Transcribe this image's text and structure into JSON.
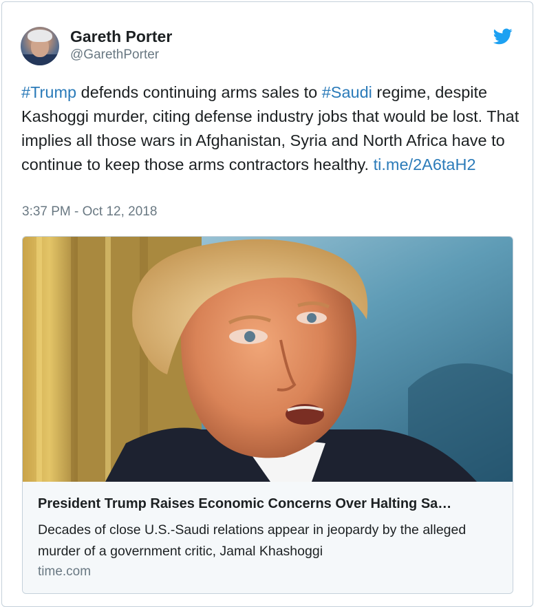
{
  "author": {
    "name": "Gareth Porter",
    "handle": "@GarethPorter"
  },
  "icons": {
    "brand": "twitter-bird-icon",
    "brand_color": "#1da1f2",
    "link_color": "#2b7bb9"
  },
  "tweet": {
    "hashtag_1": "#Trump",
    "text_1": " defends continuing arms sales to ",
    "hashtag_2": "#Saudi",
    "text_2": " regime, despite Kashoggi murder, citing defense industry jobs that would be lost. That implies all those wars in Afghanistan, Syria and North Africa have to continue to keep those arms contractors healthy. ",
    "link": "ti.me/2A6taH2",
    "timestamp": "3:37 PM - Oct 12, 2018"
  },
  "card": {
    "title": "President Trump Raises Economic Concerns Over Halting Sa…",
    "description": "Decades of close U.S.-Saudi relations appear in jeopardy by the alleged murder of a government critic, Jamal Khashoggi",
    "domain": "time.com"
  }
}
